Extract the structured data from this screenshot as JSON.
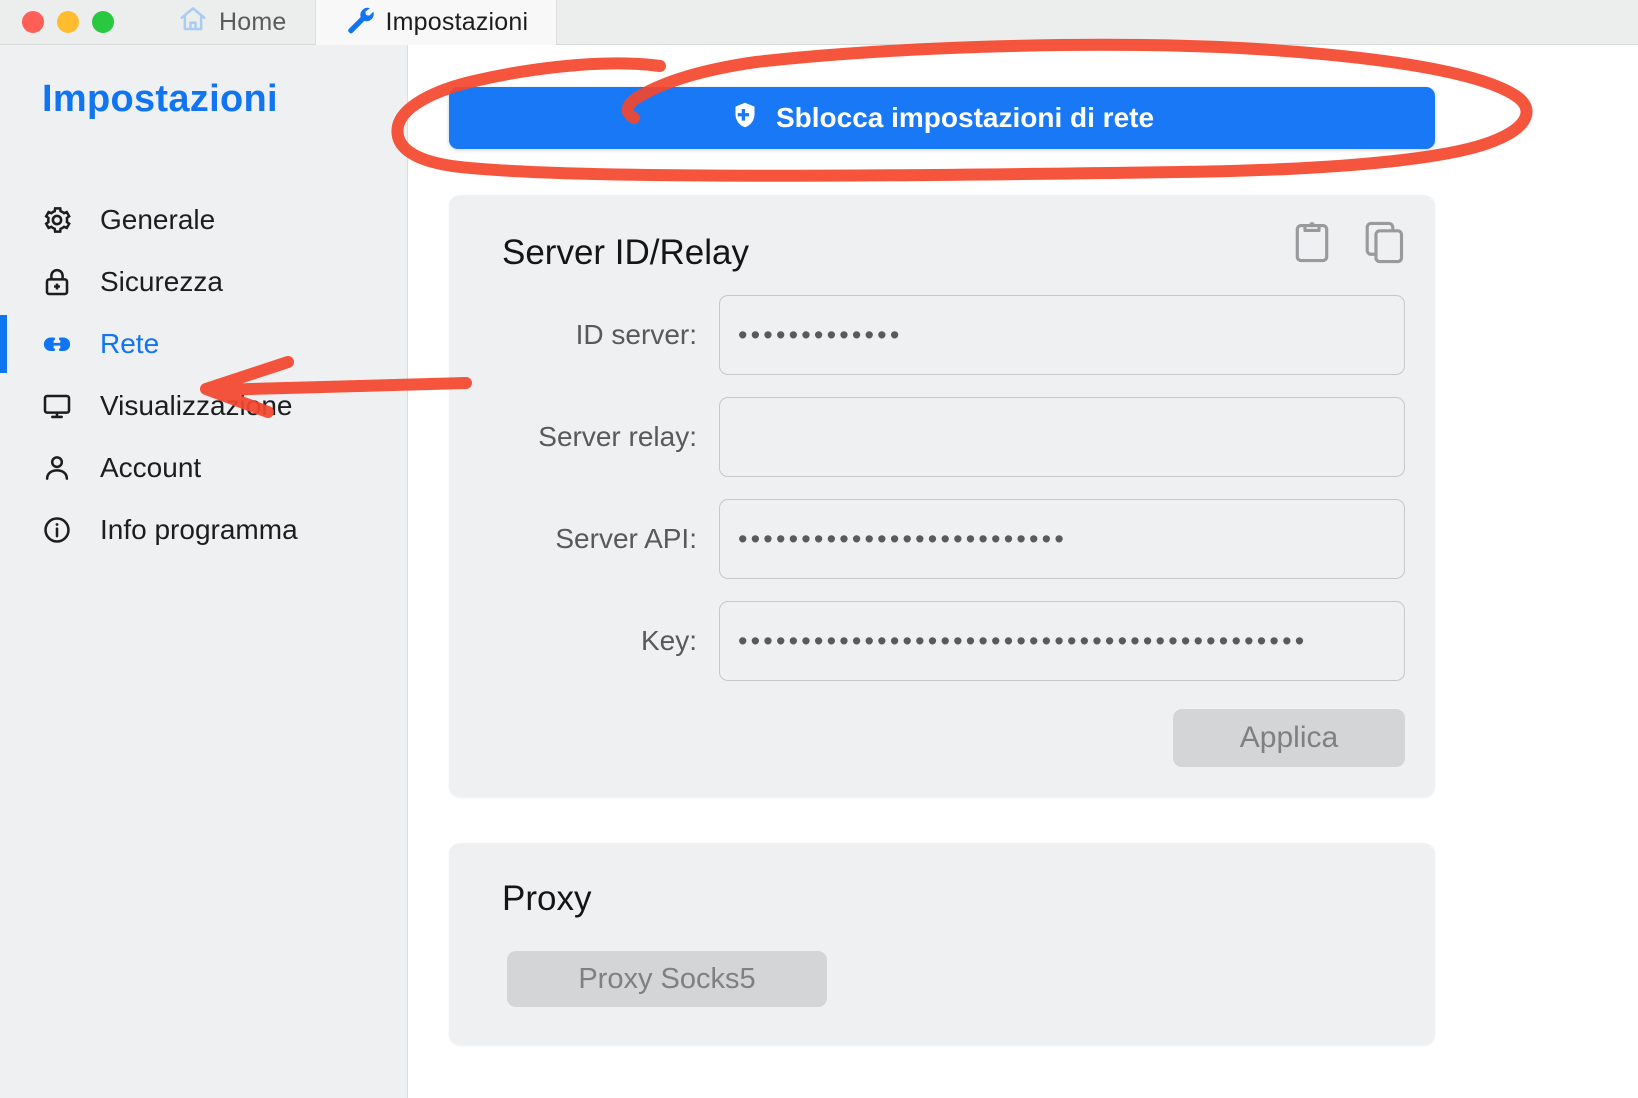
{
  "window": {
    "traffic_lights": [
      "close",
      "minimize",
      "zoom"
    ],
    "colors": {
      "close": "#ff5f57",
      "minimize": "#febc2e",
      "zoom": "#28c840",
      "accent_blue": "#1175f2",
      "button_blue": "#1878f5",
      "annotation_red": "#f4462d"
    },
    "tabs": [
      {
        "label": "Home",
        "icon": "home-icon",
        "active": false
      },
      {
        "label": "Impostazioni",
        "icon": "wrench-icon",
        "active": true
      }
    ]
  },
  "sidebar": {
    "title": "Impostazioni",
    "items": [
      {
        "label": "Generale",
        "icon": "gear-icon",
        "active": false
      },
      {
        "label": "Sicurezza",
        "icon": "lock-icon",
        "active": false
      },
      {
        "label": "Rete",
        "icon": "link-icon",
        "active": true
      },
      {
        "label": "Visualizzazione",
        "icon": "monitor-icon",
        "active": false
      },
      {
        "label": "Account",
        "icon": "person-icon",
        "active": false
      },
      {
        "label": "Info programma",
        "icon": "info-icon",
        "active": false
      }
    ]
  },
  "main": {
    "unlock_button": {
      "label": "Sblocca impostazioni di rete",
      "icon": "shield-icon"
    },
    "server_panel": {
      "title": "Server ID/Relay",
      "actions": [
        {
          "name": "paste-icon",
          "title": "Incolla"
        },
        {
          "name": "copy-icon",
          "title": "Copia"
        }
      ],
      "fields": [
        {
          "label": "ID server:",
          "value": "•••••••••••••",
          "placeholder": ""
        },
        {
          "label": "Server relay:",
          "value": "",
          "placeholder": ""
        },
        {
          "label": "Server API:",
          "value": "••••••••••••••••••••••••••",
          "placeholder": ""
        },
        {
          "label": "Key:",
          "value": "•••••••••••••••••••••••••••••••••••••••••••••",
          "placeholder": ""
        }
      ],
      "apply_label": "Applica"
    },
    "proxy_panel": {
      "title": "Proxy",
      "button_label": "Proxy Socks5"
    }
  }
}
